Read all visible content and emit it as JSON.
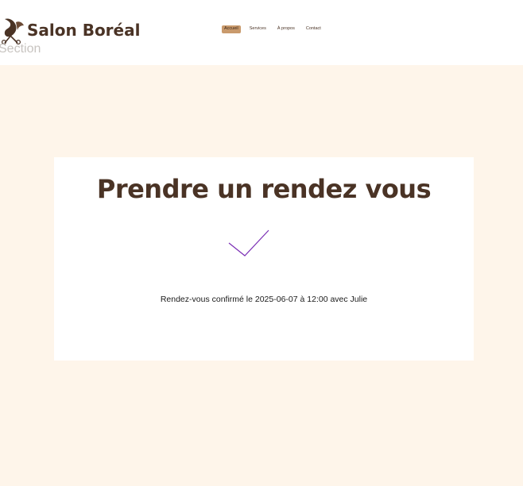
{
  "header": {
    "brand": "Salon Boréal",
    "section_label": "Section",
    "logo_icon": "hair-scissors-logo-icon",
    "nav": [
      {
        "label": "Accueil",
        "active": true
      },
      {
        "label": "Services",
        "active": false
      },
      {
        "label": "À propos",
        "active": false
      },
      {
        "label": "Contact",
        "active": false
      }
    ]
  },
  "main": {
    "title": "Prendre un rendez vous",
    "check_icon": "checkmark-icon",
    "confirmation": "Rendez-vous confirmé le 2025-06-07 à 12:00 avec Julie"
  },
  "colors": {
    "brand_brown": "#4a3325",
    "accent_tan": "#c99a6c",
    "page_background": "#fef5ea",
    "check_purple": "#7b2fb5"
  }
}
